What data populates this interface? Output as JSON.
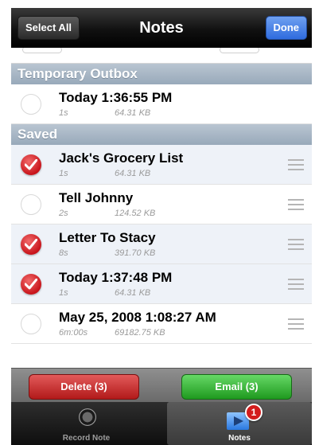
{
  "navbar": {
    "title": "Notes",
    "select_all_label": "Select All",
    "done_label": "Done"
  },
  "sections": {
    "temporary_outbox": {
      "header": "Temporary Outbox",
      "items": [
        {
          "title": "Today 1:36:55 PM",
          "duration": "1s",
          "size": "64.31 KB",
          "selected": false
        }
      ]
    },
    "saved": {
      "header": "Saved",
      "items": [
        {
          "title": "Jack's Grocery List",
          "duration": "1s",
          "size": "64.31 KB",
          "selected": true
        },
        {
          "title": "Tell Johnny",
          "duration": "2s",
          "size": "124.52 KB",
          "selected": false
        },
        {
          "title": "Letter To Stacy",
          "duration": "8s",
          "size": "391.70 KB",
          "selected": true
        },
        {
          "title": "Today 1:37:48 PM",
          "duration": "1s",
          "size": "64.31 KB",
          "selected": true
        },
        {
          "title": "May 25, 2008 1:08:27 AM",
          "duration": "6m:00s",
          "size": "69182.75 KB",
          "selected": false
        }
      ]
    }
  },
  "actions": {
    "delete_label": "Delete (3)",
    "email_label": "Email (3)"
  },
  "tabbar": {
    "tabs": [
      {
        "label": "Record Note",
        "icon": "record-icon",
        "active": false
      },
      {
        "label": "Notes",
        "icon": "notes-icon",
        "active": true,
        "badge": "1"
      }
    ]
  },
  "colors": {
    "section_header": "#a8b7c6",
    "check_red": "#c8141b",
    "delete_red": "#c83030",
    "email_green": "#2fae2f",
    "done_blue": "#3a78e2"
  }
}
